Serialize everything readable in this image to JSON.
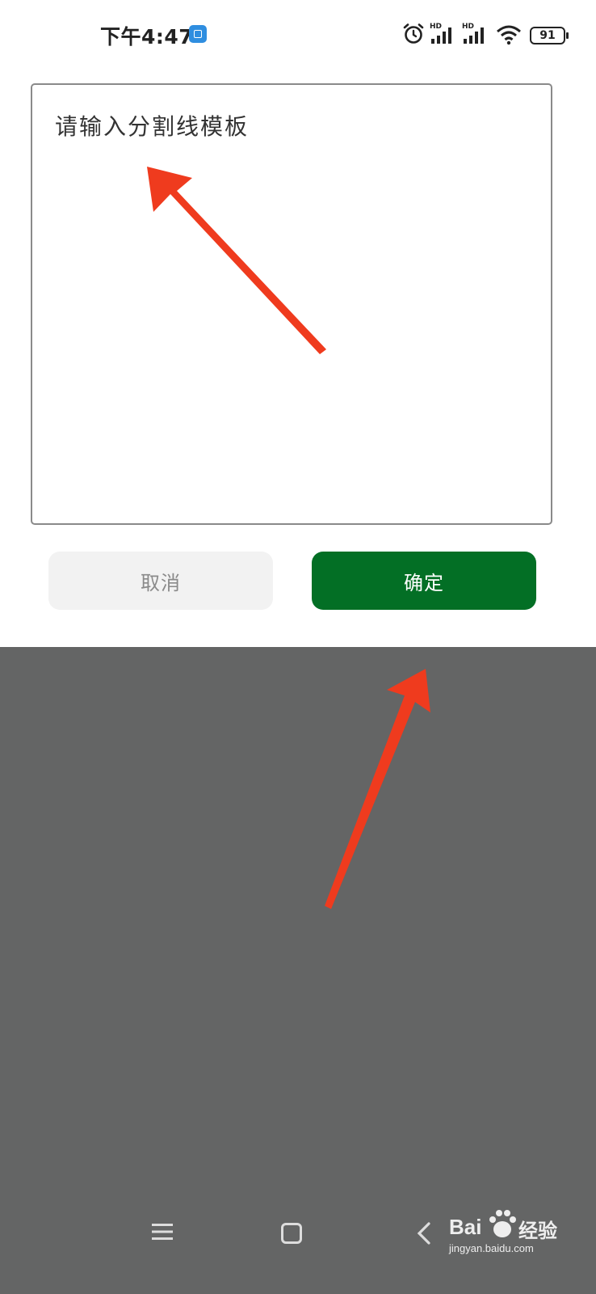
{
  "status_bar": {
    "time": "下午4:47",
    "hd_label_1": "HD",
    "hd_label_2": "HD",
    "battery_level": "91",
    "icons": [
      "app-notification-icon",
      "alarm-icon",
      "signal-icon",
      "signal-icon",
      "wifi-icon",
      "battery-icon"
    ]
  },
  "dialog": {
    "input_placeholder": "请输入分割线模板",
    "input_value": "",
    "cancel_label": "取消",
    "confirm_label": "确定"
  },
  "nav_bar": {
    "icons": [
      "menu-icon",
      "home-icon",
      "back-icon"
    ]
  },
  "watermark": {
    "brand": "Bai",
    "brand_cn": "经验",
    "domain": "jingyan.baidu.com"
  },
  "colors": {
    "confirm_bg": "#036f25",
    "cancel_bg": "#f2f2f2",
    "overlay": "#646565",
    "annotation_arrow": "#ef3b1e"
  }
}
